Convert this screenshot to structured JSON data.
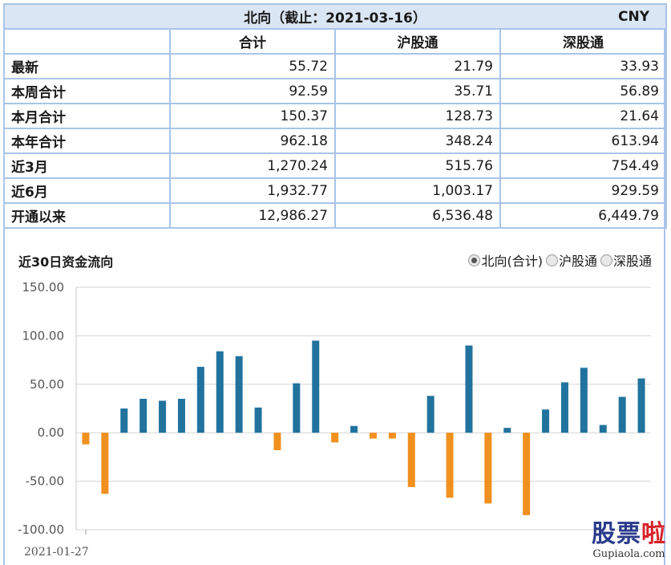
{
  "table": {
    "title": "北向（截止：2021-03-16）",
    "currency": "CNY",
    "columns": [
      "合计",
      "沪股通",
      "深股通"
    ],
    "rows": [
      {
        "label": "最新",
        "values": [
          "55.72",
          "21.79",
          "33.93"
        ]
      },
      {
        "label": "本周合计",
        "values": [
          "92.59",
          "35.71",
          "56.89"
        ]
      },
      {
        "label": "本月合计",
        "values": [
          "150.37",
          "128.73",
          "21.64"
        ]
      },
      {
        "label": "本年合计",
        "values": [
          "962.18",
          "348.24",
          "613.94"
        ]
      },
      {
        "label": "近3月",
        "values": [
          "1,270.24",
          "515.76",
          "754.49"
        ]
      },
      {
        "label": "近6月",
        "values": [
          "1,932.77",
          "1,003.17",
          "929.59"
        ]
      },
      {
        "label": "开通以来",
        "values": [
          "12,986.27",
          "6,536.48",
          "6,449.79"
        ]
      }
    ]
  },
  "chart_section": {
    "title": "近30日资金流向",
    "radio_options": [
      {
        "label": "北向(合计)",
        "selected": true
      },
      {
        "label": "沪股通",
        "selected": false
      },
      {
        "label": "深股通",
        "selected": false
      }
    ]
  },
  "chart_data": {
    "type": "bar",
    "title": "近30日资金流向",
    "ylim": [
      -100,
      150
    ],
    "yticks": [
      "150.00",
      "100.00",
      "50.00",
      "0.00",
      "-50.00",
      "-100.00"
    ],
    "first_date_label": "2021-01-27",
    "positive_color": "#21739e",
    "negative_color": "#f0901e",
    "grid": true,
    "values": [
      -12,
      -63,
      25,
      35,
      33,
      35,
      68,
      84,
      79,
      26,
      -18,
      51,
      95,
      -10,
      7,
      -6,
      -6,
      -56,
      38,
      -67,
      90,
      -73,
      5,
      -85,
      24,
      52,
      67,
      8,
      37,
      56
    ]
  },
  "watermark": {
    "main_a": "股票",
    "main_b": "啦",
    "sub": "Gupiaola.com"
  }
}
